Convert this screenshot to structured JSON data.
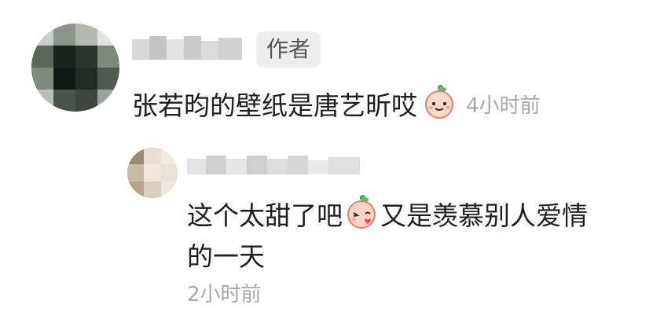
{
  "comments": [
    {
      "author_tag": "作者",
      "text": "张若昀的壁纸是唐艺昕哎",
      "emoji": "peach-smile-emoji",
      "time": "4小时前"
    },
    {
      "text_line1_a": "这个太甜了吧",
      "emoji": "peach-kiss-emoji",
      "text_line1_b": "又是羡慕别人爱情",
      "text_line2": "的一天",
      "time": "2小时前"
    }
  ],
  "colors": {
    "text": "#1f1f1f",
    "muted": "#a8a8a8",
    "tag_bg": "#eeeeee"
  }
}
